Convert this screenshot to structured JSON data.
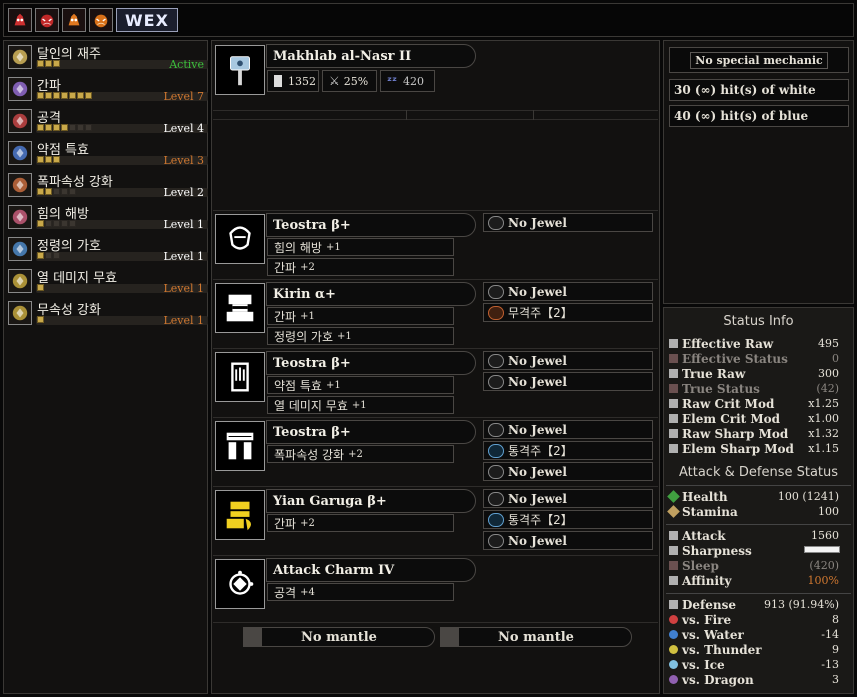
{
  "top_icons": [
    "red-monster-icon-1",
    "red-monster-icon-2",
    "orange-monster-icon-1",
    "orange-monster-icon-2"
  ],
  "wex_label": "WEX",
  "skills": [
    {
      "name": "달인의 재주",
      "level": "Active",
      "level_color": "#3cc03c",
      "pips": 3,
      "max": 3,
      "icon": "gold-skill-icon",
      "color": "#e0c060"
    },
    {
      "name": "간파",
      "level": "Level 7",
      "level_color": "#d07830",
      "pips": 7,
      "max": 7,
      "icon": "purple-skill-icon",
      "color": "#9a70d8"
    },
    {
      "name": "공격",
      "level": "Level 4",
      "level_color": "#ffffff",
      "pips": 4,
      "max": 7,
      "icon": "red-skill-icon",
      "color": "#d04848"
    },
    {
      "name": "약점 특효",
      "level": "Level 3",
      "level_color": "#d07830",
      "pips": 3,
      "max": 3,
      "icon": "blue-skill-icon",
      "color": "#5080d8"
    },
    {
      "name": "폭파속성 강화",
      "level": "Level 2",
      "level_color": "#ffffff",
      "pips": 2,
      "max": 5,
      "icon": "orange-skill-icon",
      "color": "#d07040"
    },
    {
      "name": "힘의 해방",
      "level": "Level 1",
      "level_color": "#ffffff",
      "pips": 1,
      "max": 5,
      "icon": "pink-skill-icon",
      "color": "#d06080"
    },
    {
      "name": "정령의 가호",
      "level": "Level 1",
      "level_color": "#ffffff",
      "pips": 1,
      "max": 3,
      "icon": "blue-skill-icon",
      "color": "#5090d0"
    },
    {
      "name": "열 데미지 무효",
      "level": "Level 1",
      "level_color": "#d07830",
      "pips": 1,
      "max": 1,
      "icon": "yellow-skill-icon",
      "color": "#d0b040"
    },
    {
      "name": "무속성 강화",
      "level": "Level 1",
      "level_color": "#d07830",
      "pips": 1,
      "max": 1,
      "icon": "yellow-skill-icon",
      "color": "#d0b040"
    }
  ],
  "weapon": {
    "name": "Makhlab al-Nasr II",
    "attack": "1352",
    "affinity": "25%",
    "element": "420"
  },
  "armor": [
    {
      "name": "Teostra β+",
      "skills": [
        {
          "k": "힘의 해방",
          "v": "+1"
        },
        {
          "k": "간파",
          "v": "+2"
        }
      ],
      "slots": [
        {
          "label": "No Jewel",
          "type": "empty"
        }
      ]
    },
    {
      "name": "Kirin α+",
      "skills": [
        {
          "k": "간파",
          "v": "+1"
        },
        {
          "k": "정령의 가호",
          "v": "+1"
        }
      ],
      "slots": [
        {
          "label": "No Jewel",
          "type": "empty"
        },
        {
          "label": "무격주【2】",
          "type": "red"
        }
      ]
    },
    {
      "name": "Teostra β+",
      "skills": [
        {
          "k": "약점 특효",
          "v": "+1"
        },
        {
          "k": "열 데미지 무효",
          "v": "+1"
        }
      ],
      "slots": [
        {
          "label": "No Jewel",
          "type": "empty"
        },
        {
          "label": "No Jewel",
          "type": "empty"
        }
      ]
    },
    {
      "name": "Teostra β+",
      "skills": [
        {
          "k": "폭파속성 강화",
          "v": "+2"
        }
      ],
      "slots": [
        {
          "label": "No Jewel",
          "type": "empty"
        },
        {
          "label": "통격주【2】",
          "type": "blue"
        },
        {
          "label": "No Jewel",
          "type": "empty"
        }
      ]
    },
    {
      "name": "Yian Garuga β+",
      "skills": [
        {
          "k": "간파",
          "v": "+2"
        }
      ],
      "slots": [
        {
          "label": "No Jewel",
          "type": "empty"
        },
        {
          "label": "통격주【2】",
          "type": "blue"
        },
        {
          "label": "No Jewel",
          "type": "empty"
        }
      ]
    },
    {
      "name": "Attack Charm IV",
      "skills": [
        {
          "k": "공격",
          "v": "+4"
        }
      ],
      "slots": []
    }
  ],
  "mantles": [
    "No mantle",
    "No mantle"
  ],
  "mechanic": {
    "title": "No special mechanic",
    "lines": [
      "30 (∞) hit(s) of white",
      "40 (∞) hit(s) of blue"
    ]
  },
  "status": {
    "title": "Status Info",
    "rows": [
      {
        "l": "Effective Raw",
        "v": "495",
        "dim": false
      },
      {
        "l": "Effective Status",
        "v": "0",
        "dim": true
      },
      {
        "l": "True Raw",
        "v": "300",
        "dim": false
      },
      {
        "l": "True Status",
        "v": "(42)",
        "dim": true
      },
      {
        "l": "Raw Crit Mod",
        "v": "x1.25",
        "dim": false
      },
      {
        "l": "Elem Crit Mod",
        "v": "x1.00",
        "dim": false
      },
      {
        "l": "Raw Sharp Mod",
        "v": "x1.32",
        "dim": false
      },
      {
        "l": "Elem Sharp Mod",
        "v": "x1.15",
        "dim": false
      }
    ],
    "ad_title": "Attack & Defense Status",
    "hs": [
      {
        "l": "Health",
        "v": "100 (1241)"
      },
      {
        "l": "Stamina",
        "v": "100"
      }
    ],
    "atk": [
      {
        "l": "Attack",
        "v": "1560",
        "dim": false
      },
      {
        "l": "Sharpness",
        "v": "",
        "dim": false
      },
      {
        "l": "Sleep",
        "v": "(420)",
        "dim": true
      },
      {
        "l": "Affinity",
        "v": "100%",
        "dim": false,
        "color": "#d07830"
      }
    ],
    "def": [
      {
        "l": "Defense",
        "v": "913 (91.94%)"
      },
      {
        "l": "vs. Fire",
        "v": "8"
      },
      {
        "l": "vs. Water",
        "v": "-14"
      },
      {
        "l": "vs. Thunder",
        "v": "9"
      },
      {
        "l": "vs. Ice",
        "v": "-13"
      },
      {
        "l": "vs. Dragon",
        "v": "3"
      }
    ]
  }
}
